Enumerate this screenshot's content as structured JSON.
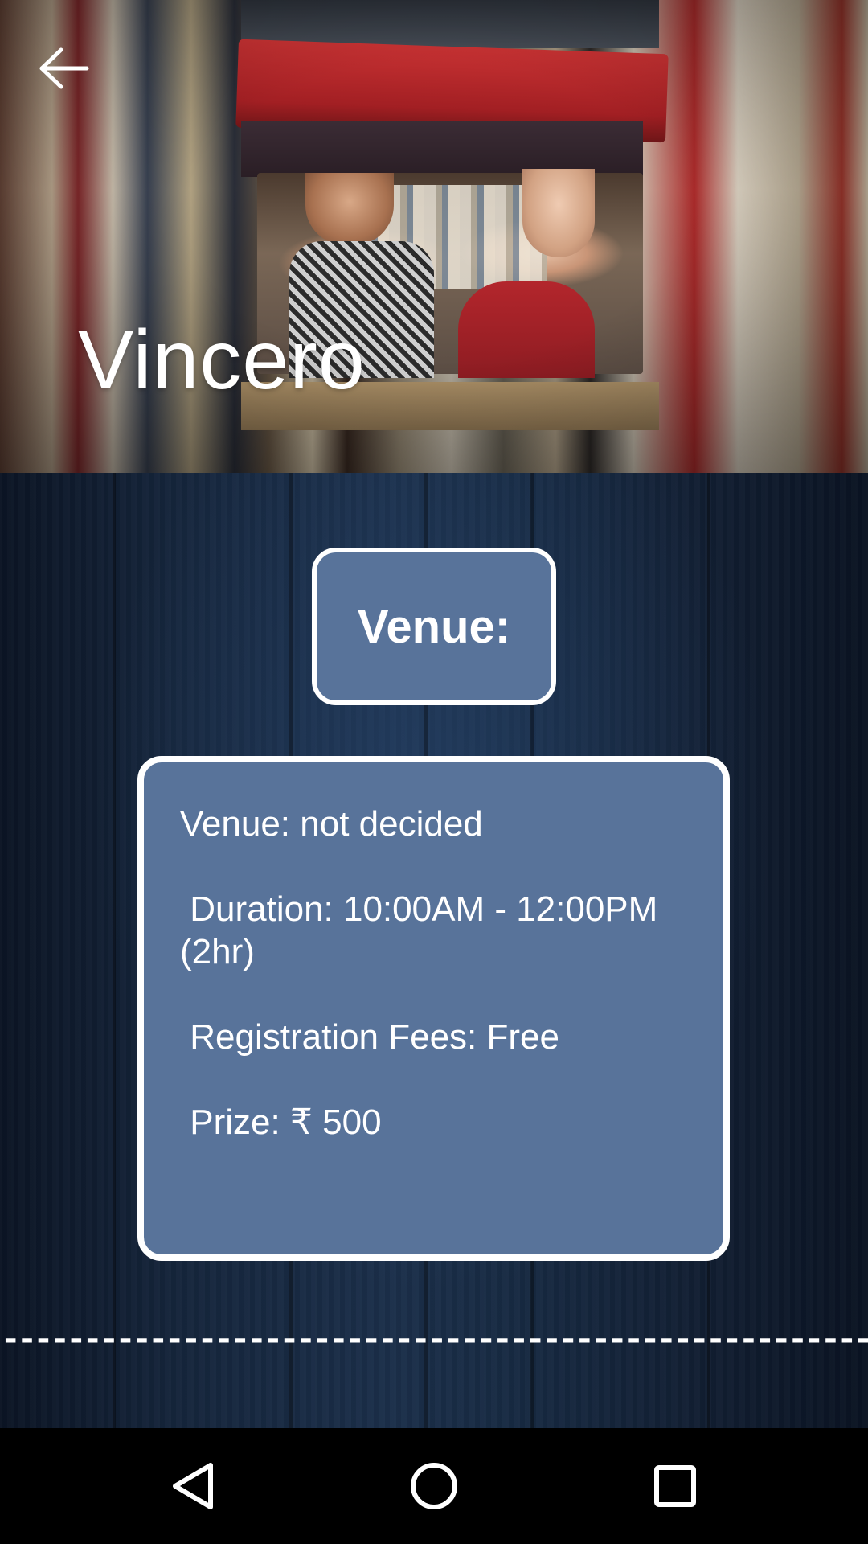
{
  "header": {
    "title": "Vincero",
    "back_icon": "arrow-left-icon"
  },
  "venue_header": {
    "label": "Venue:"
  },
  "details": {
    "lines": [
      "Venue: not decided",
      " Duration: 10:00AM - 12:00PM (2hr)",
      " Registration Fees: Free",
      " Prize: ₹ 500"
    ]
  },
  "divider": {
    "text": "--------------------------------------------------------"
  },
  "navbar": {
    "back_icon": "triangle-back-icon",
    "home_icon": "circle-home-icon",
    "recents_icon": "square-recents-icon"
  },
  "colors": {
    "card_fill": "#58739a",
    "card_border": "#ffffff",
    "body_bg": "#15253b",
    "navbar_bg": "#000000"
  }
}
